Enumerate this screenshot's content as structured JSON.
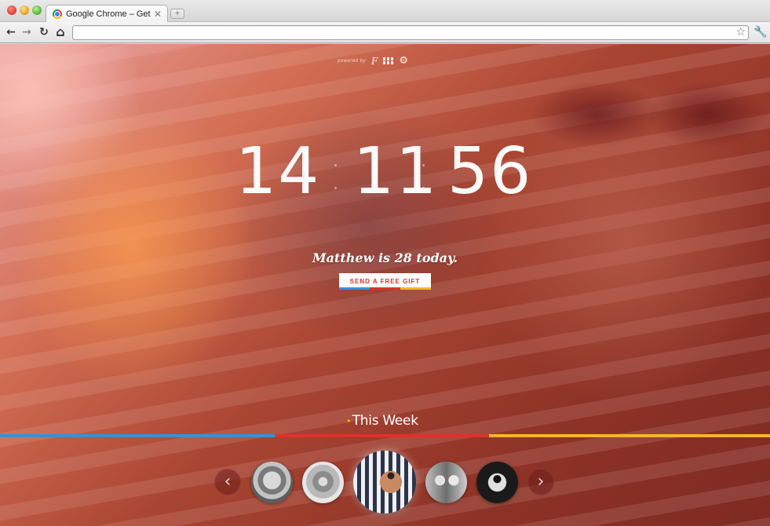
{
  "browser": {
    "tab_title": "Google Chrome – Get a fast",
    "tab_close": "✕",
    "new_tab": "+",
    "url": "",
    "nav": {
      "back": "←",
      "forward": "→",
      "reload": "↻",
      "home": "⌂"
    },
    "star": "☆",
    "wrench": "🔧"
  },
  "top_bar": {
    "powered_by": "powered by",
    "logo_letter": "F",
    "icons": [
      "grid-icon",
      "gear-icon"
    ],
    "gear_glyph": "⚙"
  },
  "clock": {
    "hours": "14",
    "minutes": "11",
    "seconds": "56"
  },
  "birthday": {
    "message": "Matthew is 28 today.",
    "button_label": "SEND A FREE GIFT",
    "stripe_colors": [
      "#3a8fd6",
      "#d9342b",
      "#f3b62b"
    ]
  },
  "week": {
    "label": "This Week",
    "arrow": "▸",
    "timeline_colors": [
      "#3a8fd6",
      "#d9342b",
      "#f3b62b"
    ]
  },
  "carousel": {
    "prev": "‹",
    "next": "›",
    "friends_count": 5,
    "selected_index": 2
  },
  "colors": {
    "accent_blue": "#3a8fd6",
    "accent_red": "#d9342b",
    "accent_yellow": "#f3b62b"
  }
}
